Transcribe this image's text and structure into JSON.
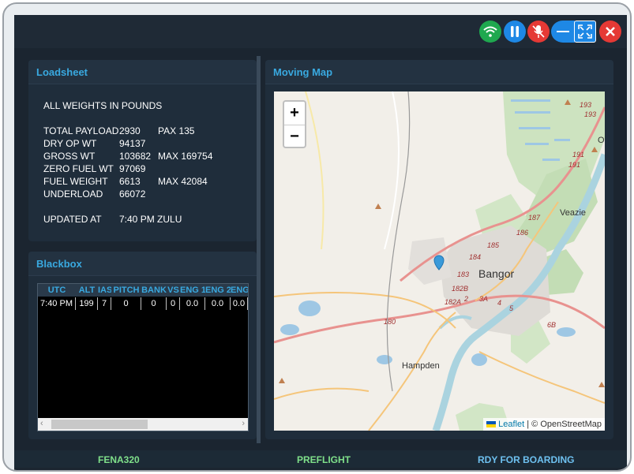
{
  "window_controls": [
    {
      "name": "wifi-button",
      "icon": "wifi-icon",
      "color": "#1fa84f"
    },
    {
      "name": "pause-button",
      "icon": "pause-icon",
      "color": "#1e88e5"
    },
    {
      "name": "mic-muted-button",
      "icon": "mic-off-icon",
      "color": "#e53935"
    },
    {
      "name": "minimize-button",
      "icon": "minimize-icon",
      "color": "#1e88e5"
    },
    {
      "name": "fullscreen-button",
      "icon": "fullscreen-icon",
      "color": "#1e88e5"
    },
    {
      "name": "close-button",
      "icon": "close-icon",
      "color": "#e53935"
    }
  ],
  "loadsheet": {
    "title": "Loadsheet",
    "header": "ALL WEIGHTS IN POUNDS",
    "rows": [
      {
        "label": "TOTAL PAYLOAD",
        "value": "2930",
        "extra": "PAX  135"
      },
      {
        "label": "DRY OP WT",
        "value": "94137",
        "extra": ""
      },
      {
        "label": "GROSS WT",
        "value": "103682",
        "extra": "MAX  169754"
      },
      {
        "label": "ZERO FUEL WT",
        "value": "97069",
        "extra": ""
      },
      {
        "label": "FUEL WEIGHT",
        "value": "6613",
        "extra": "MAX  42084"
      },
      {
        "label": "UNDERLOAD",
        "value": "66072",
        "extra": ""
      }
    ],
    "updated_label": "UPDATED AT",
    "updated_value": "7:40 PM ZULU"
  },
  "blackbox": {
    "title": "Blackbox",
    "columns": [
      "UTC",
      "ALT",
      "IAS",
      "PITCH",
      "BANK",
      "VS",
      "ENG 1",
      "ENG 2",
      "ENG"
    ],
    "row": [
      "7:40 PM",
      "199",
      "7",
      "0",
      "0",
      "0",
      "0.0",
      "0.0",
      "0.0"
    ]
  },
  "map": {
    "title": "Moving Map",
    "zoom_in": "+",
    "zoom_out": "−",
    "labels": {
      "city": "Bangor",
      "town1": "Hampden",
      "town2": "Veazie",
      "edge_o": "O"
    },
    "road_numbers": [
      "193",
      "193",
      "191",
      "191",
      "187",
      "186",
      "185",
      "184",
      "183",
      "182B",
      "182A",
      "2",
      "3A",
      "4",
      "5",
      "6B",
      "180"
    ],
    "attribution_leaflet": "Leaflet",
    "attribution_sep": " | © ",
    "attribution_osm": "OpenStreetMap"
  },
  "status": {
    "aircraft": "FENA320",
    "phase": "PREFLIGHT",
    "state": "RDY FOR BOARDING"
  }
}
